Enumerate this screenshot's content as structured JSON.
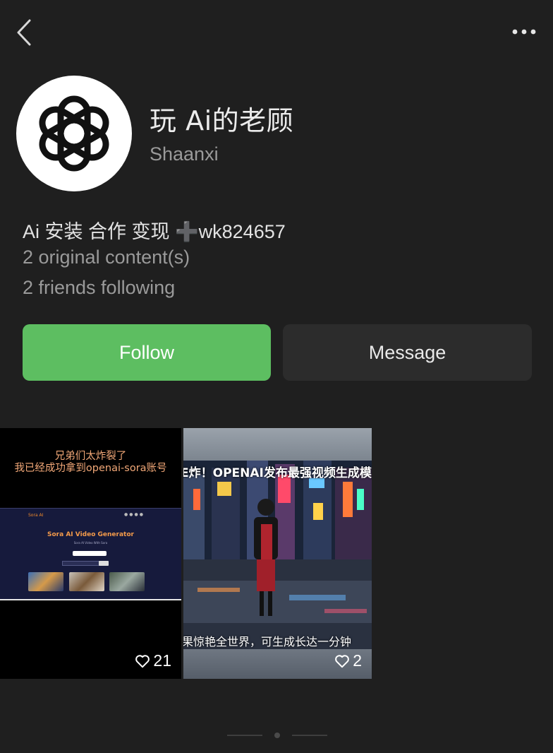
{
  "profile": {
    "name": "玩 Ai的老顾",
    "region": "Shaanxi",
    "bio_prefix": "Ai 安装 合作 变现",
    "bio_plus": "➕",
    "bio_suffix": "wk824657",
    "original_content": "2 original content(s)",
    "friends_following": "2 friends following"
  },
  "actions": {
    "follow_label": "Follow",
    "message_label": "Message"
  },
  "posts": [
    {
      "caption_lines": [
        "兄弟们太炸裂了",
        "我已经成功拿到openai-sora账号"
      ],
      "screenshot": {
        "logo": "Sora AI",
        "title": "Sora AI Video Generator",
        "subtitle": "Sora AI Video With Sora"
      },
      "likes": "21"
    },
    {
      "caption_top": "E炸！OPENAI发布最强视频生成模型-S",
      "caption_bottom": "果惊艳全世界，可生成长达一分钟",
      "likes": "2"
    }
  ],
  "colors": {
    "background": "#1f1f1f",
    "follow_green": "#5dbe61",
    "message_bg": "#2c2c2c",
    "secondary_text": "#9a9a9a"
  },
  "icons": [
    "back-chevron-icon",
    "more-dots-icon",
    "openai-logo-icon",
    "heart-icon"
  ]
}
